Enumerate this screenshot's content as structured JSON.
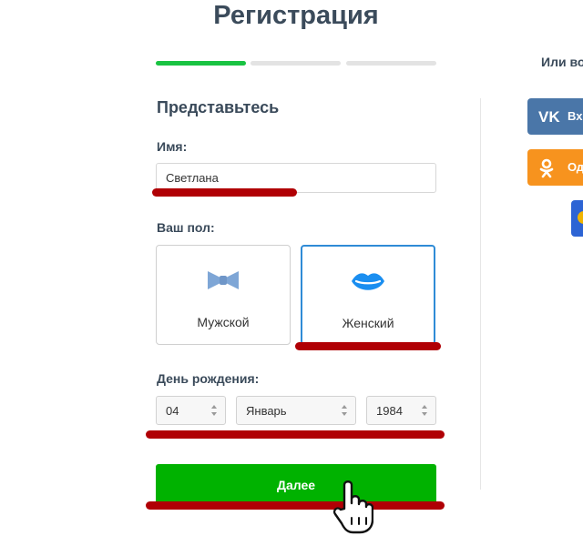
{
  "page": {
    "title": "Регистрация"
  },
  "progress": {
    "steps": 3,
    "current": 1
  },
  "social": {
    "or_text": "Или во",
    "vk_label": "Вх",
    "ok_label": "Од"
  },
  "form": {
    "section_title": "Представьтесь",
    "name_label": "Имя:",
    "name_value": "Светлана",
    "gender_label": "Ваш пол:",
    "gender_male": "Мужской",
    "gender_female": "Женский",
    "gender_selected": "female",
    "birthday_label": "День рождения:",
    "day": "04",
    "month": "Январь",
    "year": "1984",
    "next_label": "Далее"
  },
  "colors": {
    "progress_active": "#19c342",
    "progress_inactive": "#e3e3e3",
    "button_green": "#00b200",
    "selected_border": "#2f8bd6",
    "underline_red": "#b00005",
    "vk": "#4a76a8",
    "ok": "#f7931e"
  }
}
